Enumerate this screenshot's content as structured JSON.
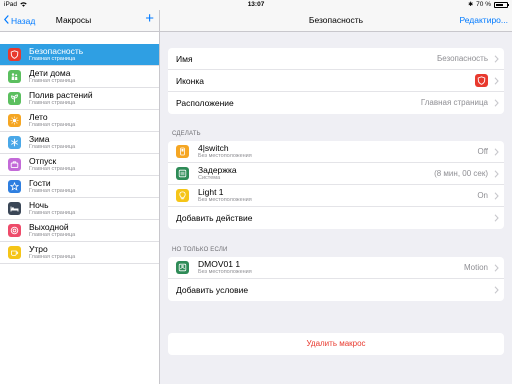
{
  "statusbar": {
    "carrier": "iPad",
    "time": "13:07",
    "battery": "70 %",
    "battery_level": 0.7
  },
  "left": {
    "back_label": "Назад",
    "title": "Макросы",
    "add_label": "+",
    "items": [
      {
        "name": "Безопасность",
        "sub": "Главная страница",
        "color": "#e8392e",
        "icon": "shield-icon",
        "selected": true
      },
      {
        "name": "Дети дома",
        "sub": "Главная страница",
        "color": "#5bbf5f",
        "icon": "children-icon",
        "selected": false
      },
      {
        "name": "Полив растений",
        "sub": "Главная страница",
        "color": "#5bbf5f",
        "icon": "plant-icon",
        "selected": false
      },
      {
        "name": "Лето",
        "sub": "Главная страница",
        "color": "#f5a623",
        "icon": "sun-icon",
        "selected": false
      },
      {
        "name": "Зима",
        "sub": "Главная страница",
        "color": "#4aa8e8",
        "icon": "snowflake-icon",
        "selected": false
      },
      {
        "name": "Отпуск",
        "sub": "Главная страница",
        "color": "#c36ad8",
        "icon": "suitcase-icon",
        "selected": false
      },
      {
        "name": "Гости",
        "sub": "Главная страница",
        "color": "#2f7fe0",
        "icon": "star-icon",
        "selected": false
      },
      {
        "name": "Ночь",
        "sub": "Главная страница",
        "color": "#3a4656",
        "icon": "bed-icon",
        "selected": false
      },
      {
        "name": "Выходной",
        "sub": "Главная страница",
        "color": "#ee4b6a",
        "icon": "lifebuoy-icon",
        "selected": false
      },
      {
        "name": "Утро",
        "sub": "Главная страница",
        "color": "#f5c518",
        "icon": "coffee-icon",
        "selected": false
      }
    ]
  },
  "right": {
    "title": "Безопасность",
    "edit_label": "Редактиро...",
    "info": {
      "name_label": "Имя",
      "name_value": "Безопасность",
      "icon_label": "Иконка",
      "location_label": "Расположение",
      "location_value": "Главная страница"
    },
    "do_header": "СДЕЛАТЬ",
    "actions": [
      {
        "name": "4|switch",
        "sub": "Без местоположения",
        "value": "Off",
        "color": "#f5a623",
        "icon": "switch-icon"
      },
      {
        "name": "Задержка",
        "sub": "Система",
        "value": "(8 мин, 00 сек)",
        "color": "#2e8b57",
        "icon": "timer-icon"
      },
      {
        "name": "Light 1",
        "sub": "Без местоположения",
        "value": "On",
        "color": "#f5c518",
        "icon": "bulb-icon"
      }
    ],
    "add_action_label": "Добавить действие",
    "if_header": "НО ТОЛЬКО ЕСЛИ",
    "conditions": [
      {
        "name": "DMOV01 1",
        "sub": "Без местоположения",
        "value": "Motion",
        "color": "#2e8b57",
        "icon": "sensor-icon"
      }
    ],
    "add_condition_label": "Добавить условие",
    "delete_label": "Удалить макрос"
  }
}
